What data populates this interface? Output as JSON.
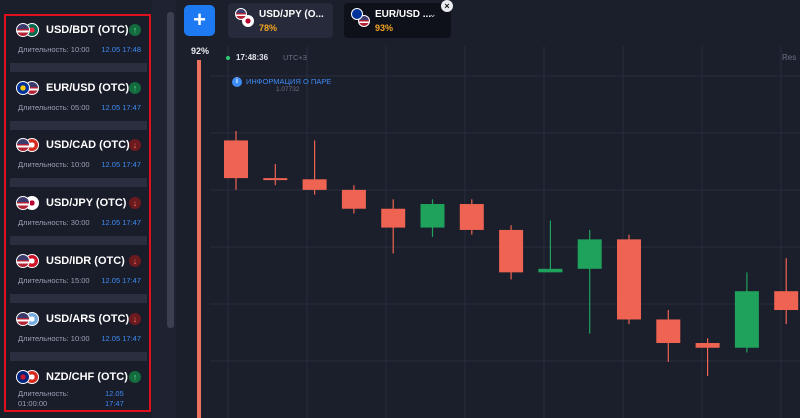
{
  "trades": [
    {
      "pair": "USD/BDT (OTC)",
      "direction": "up",
      "duration_label": "Длительность: 10:00",
      "time": "12.05 17:48",
      "flag1": [
        "#b22234",
        "#ffffff",
        "#3c3b6e"
      ],
      "flag2": [
        "#006a4e",
        "#f42a41"
      ]
    },
    {
      "pair": "EUR/USD (OTC)",
      "direction": "up",
      "duration_label": "Длительность: 05:00",
      "time": "12.05 17:47",
      "flag1": [
        "#003399",
        "#ffcc00"
      ],
      "flag2": [
        "#b22234",
        "#ffffff",
        "#3c3b6e"
      ]
    },
    {
      "pair": "USD/CAD (OTC)",
      "direction": "down",
      "duration_label": "Длительность: 10:00",
      "time": "12.05 17:47",
      "flag1": [
        "#b22234",
        "#ffffff",
        "#3c3b6e"
      ],
      "flag2": [
        "#d52b1e",
        "#ffffff"
      ]
    },
    {
      "pair": "USD/JPY (OTC)",
      "direction": "down",
      "duration_label": "Длительность: 30:00",
      "time": "12.05 17:47",
      "flag1": [
        "#b22234",
        "#ffffff",
        "#3c3b6e"
      ],
      "flag2": [
        "#ffffff",
        "#bc002d"
      ]
    },
    {
      "pair": "USD/IDR (OTC)",
      "direction": "down",
      "duration_label": "Длительность: 15:00",
      "time": "12.05 17:47",
      "flag1": [
        "#b22234",
        "#ffffff",
        "#3c3b6e"
      ],
      "flag2": [
        "#ce1126",
        "#ffffff"
      ]
    },
    {
      "pair": "USD/ARS (OTC)",
      "direction": "down",
      "duration_label": "Длительность: 10:00",
      "time": "12.05 17:47",
      "flag1": [
        "#b22234",
        "#ffffff",
        "#3c3b6e"
      ],
      "flag2": [
        "#74acdf",
        "#ffffff"
      ]
    },
    {
      "pair": "NZD/CHF (OTC)",
      "direction": "up",
      "duration_label_1": "Длительность:",
      "duration_label_2": "01:00:00",
      "time_1": "12.05",
      "time_2": "17:47",
      "flag1": [
        "#00247d",
        "#cc142b"
      ],
      "flag2": [
        "#d52b1e",
        "#ffffff"
      ]
    }
  ],
  "add_button": {
    "label": "+"
  },
  "payout_left": "92%",
  "tabs": [
    {
      "pair": "USD/JPY (O...",
      "pct": "78%"
    },
    {
      "pair": "EUR/USD ...",
      "pct": "93%",
      "chevron": "⌄",
      "close": "×"
    }
  ],
  "chart_header": {
    "time": "17:48:36",
    "tz": "UTC+3",
    "right_hint": "Res",
    "info_text": "ИНФОРМАЦИЯ О ПАРЕ",
    "price": "1.07732"
  },
  "colors": {
    "bull": "#1ea25c",
    "bear": "#ef6352",
    "grid": "#2a2e3d"
  },
  "candles": [
    {
      "o": 72,
      "c": 56,
      "h": 76,
      "l": 51
    },
    {
      "o": 56,
      "c": 55.5,
      "h": 62,
      "l": 53
    },
    {
      "o": 55.5,
      "c": 51,
      "h": 72,
      "l": 49
    },
    {
      "o": 51,
      "c": 43,
      "h": 53,
      "l": 41
    },
    {
      "o": 43,
      "c": 35,
      "h": 47,
      "l": 24
    },
    {
      "o": 35,
      "c": 45,
      "h": 47,
      "l": 31
    },
    {
      "o": 45,
      "c": 34,
      "h": 47,
      "l": 32
    },
    {
      "o": 34,
      "c": 16,
      "h": 36,
      "l": 13
    },
    {
      "o": 16,
      "c": 17.5,
      "h": 38,
      "l": 16
    },
    {
      "o": 17.5,
      "c": 30,
      "h": 34,
      "l": -10
    },
    {
      "o": 30,
      "c": -4,
      "h": 32,
      "l": -6
    },
    {
      "o": -4,
      "c": -14,
      "h": 0,
      "l": -22
    },
    {
      "o": -14,
      "c": -16,
      "h": -12,
      "l": -28
    },
    {
      "o": -16,
      "c": 8,
      "h": 16,
      "l": -18
    },
    {
      "o": 8,
      "c": 0,
      "h": 22,
      "l": -6
    }
  ]
}
